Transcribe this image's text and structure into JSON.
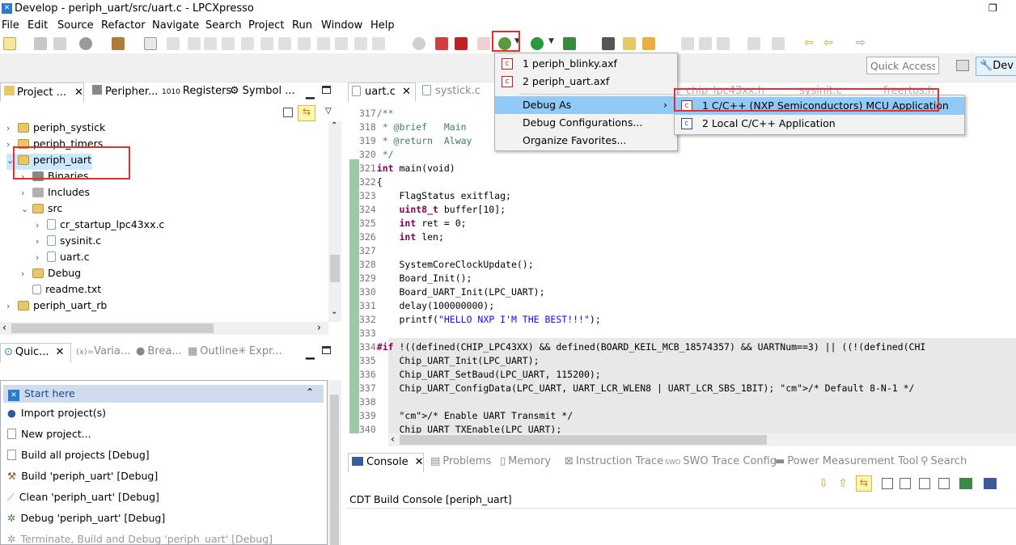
{
  "window": {
    "title": "Develop - periph_uart/src/uart.c - LPCXpresso"
  },
  "menubar": [
    "File",
    "Edit",
    "Source",
    "Refactor",
    "Navigate",
    "Search",
    "Project",
    "Run",
    "Window",
    "Help"
  ],
  "quick_access": {
    "placeholder": "Quick Access"
  },
  "perspective": {
    "label": "Dev"
  },
  "project_panel": {
    "tabs": [
      "Project ...",
      "Peripher...",
      "Registers",
      "Symbol ..."
    ],
    "tree": [
      {
        "label": "periph_systick"
      },
      {
        "label": "periph_timers"
      },
      {
        "label": "periph_uart"
      },
      {
        "label": "Binaries"
      },
      {
        "label": "Includes"
      },
      {
        "label": "src"
      },
      {
        "label": "cr_startup_lpc43xx.c"
      },
      {
        "label": "sysinit.c"
      },
      {
        "label": "uart.c"
      },
      {
        "label": "Debug"
      },
      {
        "label": "readme.txt"
      },
      {
        "label": "periph_uart_rb"
      }
    ]
  },
  "quickstart_panel": {
    "tabs": [
      "Quic...",
      "Varia...",
      "Brea...",
      "Outline",
      "Expr..."
    ],
    "header": "Start here",
    "items": [
      "Import project(s)",
      "New project...",
      "Build all projects [Debug]",
      "Build 'periph_uart' [Debug]",
      "Clean 'periph_uart' [Debug]",
      "Debug 'periph_uart' [Debug]",
      "Terminate, Build and Debug 'periph_uart' [Debug]"
    ]
  },
  "editor": {
    "tabs": [
      "uart.c",
      "systick.c"
    ],
    "lines": [
      {
        "n": "317",
        "text": "/**",
        "cls": "cm"
      },
      {
        "n": "318",
        "text": " * @brief   Main",
        "cls": "cm"
      },
      {
        "n": "319",
        "text": " * @return  Alway",
        "cls": "cm"
      },
      {
        "n": "320",
        "text": " */",
        "cls": "cm"
      },
      {
        "n": "321",
        "text": "int main(void)",
        "cls": ""
      },
      {
        "n": "322",
        "text": "{",
        "cls": ""
      },
      {
        "n": "323",
        "text": "    FlagStatus exitflag;",
        "cls": ""
      },
      {
        "n": "324",
        "text": "    uint8_t buffer[10];",
        "cls": ""
      },
      {
        "n": "325",
        "text": "    int ret = 0;",
        "cls": ""
      },
      {
        "n": "326",
        "text": "    int len;",
        "cls": ""
      },
      {
        "n": "327",
        "text": "",
        "cls": ""
      },
      {
        "n": "328",
        "text": "    SystemCoreClockUpdate();",
        "cls": ""
      },
      {
        "n": "329",
        "text": "    Board_Init();",
        "cls": ""
      },
      {
        "n": "330",
        "text": "    Board_UART_Init(LPC_UART);",
        "cls": ""
      },
      {
        "n": "331",
        "text": "    delay(100000000);",
        "cls": ""
      },
      {
        "n": "332",
        "text": "    printf(\"HELLO NXP I'M THE BEST!!!\");",
        "cls": ""
      },
      {
        "n": "333",
        "text": "",
        "cls": ""
      },
      {
        "n": "334",
        "text": "#if !((defined(CHIP_LPC43XX) && defined(BOARD_KEIL_MCB_18574357) && UARTNum==3) || ((!(defined(CHI",
        "cls": "pp"
      },
      {
        "n": "335",
        "text": "    Chip_UART_Init(LPC_UART);",
        "cls": "pp"
      },
      {
        "n": "336",
        "text": "    Chip_UART_SetBaud(LPC_UART, 115200);",
        "cls": "pp"
      },
      {
        "n": "337",
        "text": "    Chip_UART_ConfigData(LPC_UART, UART_LCR_WLEN8 | UART_LCR_SBS_1BIT); /* Default 8-N-1 */",
        "cls": "pp"
      },
      {
        "n": "338",
        "text": "",
        "cls": "pp"
      },
      {
        "n": "339",
        "text": "    /* Enable UART Transmit */",
        "cls": "pp"
      },
      {
        "n": "340",
        "text": "    Chip_UART_TXEnable(LPC_UART);",
        "cls": "pp"
      }
    ]
  },
  "console_panel": {
    "tabs": [
      "Console",
      "Problems",
      "Memory",
      "Instruction Trace",
      "SWO Trace Config",
      "Power Measurement Tool",
      "Search"
    ],
    "title": "CDT Build Console [periph_uart]"
  },
  "debug_menu": {
    "items": [
      "1 periph_blinky.axf",
      "2 periph_uart.axf",
      "Debug As",
      "Debug Configurations...",
      "Organize Favorites..."
    ]
  },
  "debug_as_submenu": {
    "items": [
      "1 C/C++ (NXP Semiconductors) MCU Application",
      "2 Local C/C++ Application"
    ]
  },
  "behind_tabs": [
    "chip_lpc43xx.h",
    "sysinit.c",
    "freertos.h"
  ],
  "colors": {
    "accent": "#3399ff",
    "highlight": "#e03030",
    "menu_selected": "#91c9f7"
  }
}
